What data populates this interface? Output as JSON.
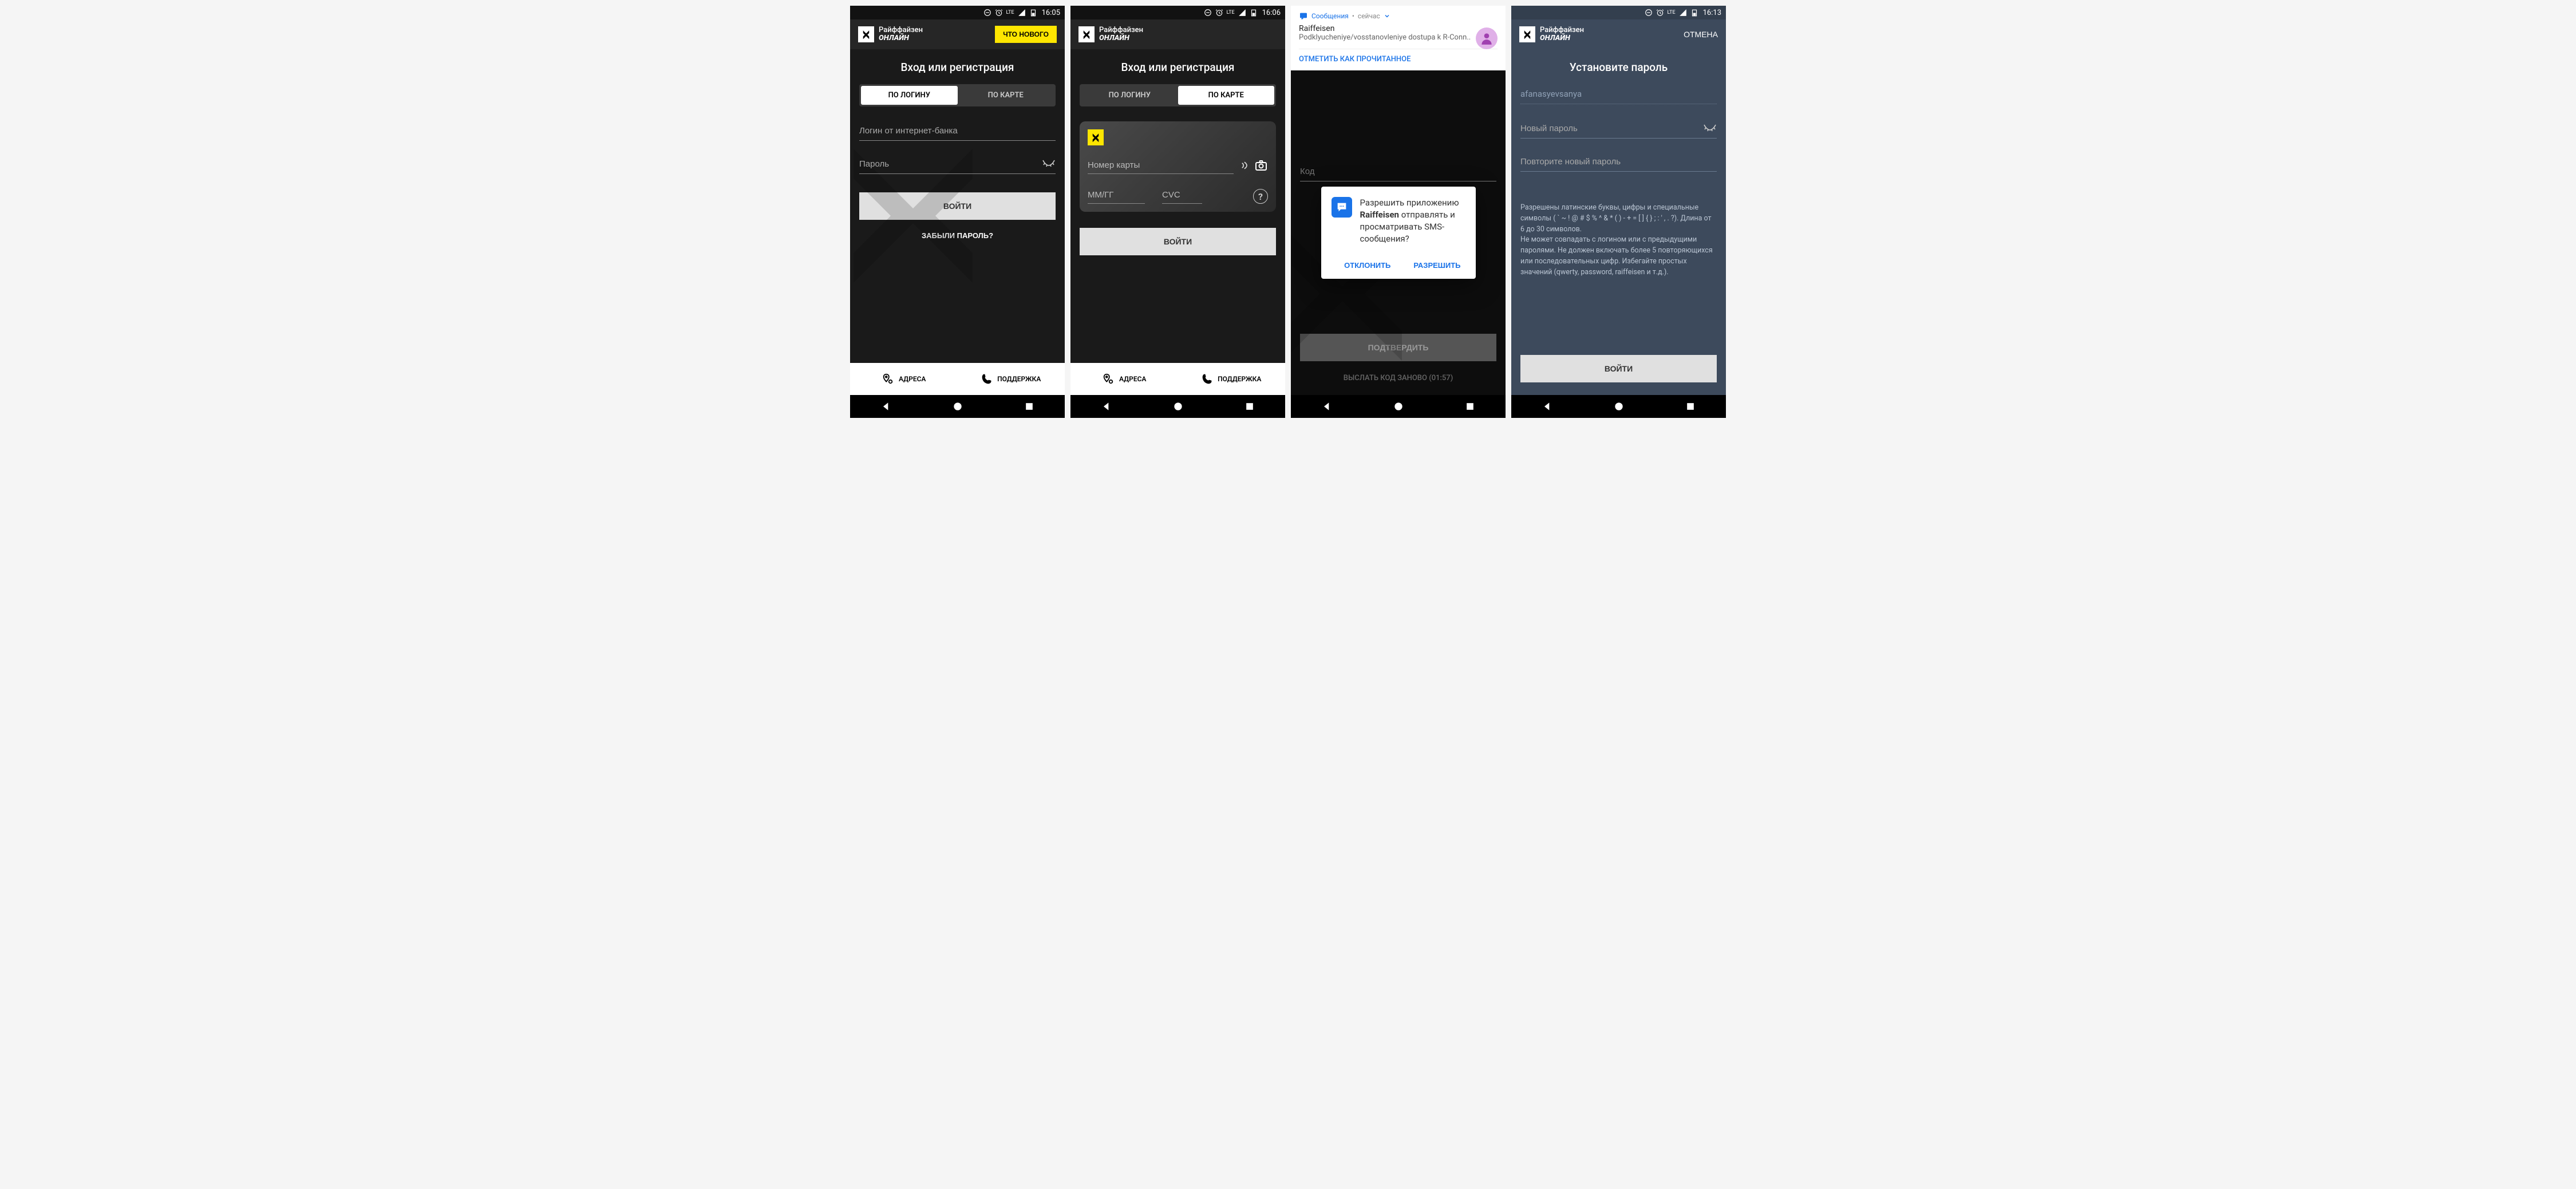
{
  "status": {
    "time1": "16:05",
    "time2": "16:06",
    "time4": "16:13",
    "net": "LTE"
  },
  "brand": {
    "line1": "Райффайзен",
    "line2": "ОНЛАЙН"
  },
  "screen1": {
    "whatsNew": "ЧТО НОВОГО",
    "title": "Вход или регистрация",
    "tabLogin": "ПО ЛОГИНУ",
    "tabCard": "ПО КАРТЕ",
    "loginPlaceholder": "Логин от интернет-банка",
    "passwordPlaceholder": "Пароль",
    "loginBtn": "ВОЙТИ",
    "forgot": "ЗАБЫЛИ ПАРОЛЬ?",
    "addresses": "АДРЕСА",
    "support": "ПОДДЕРЖКА"
  },
  "screen2": {
    "title": "Вход или регистрация",
    "tabLogin": "ПО ЛОГИНУ",
    "tabCard": "ПО КАРТЕ",
    "cardNumberPlaceholder": "Номер карты",
    "expPlaceholder": "ММ/ГГ",
    "cvcPlaceholder": "CVC",
    "loginBtn": "ВОЙТИ",
    "addresses": "АДРЕСА",
    "support": "ПОДДЕРЖКА"
  },
  "screen3": {
    "notifApp": "Сообщения",
    "notifWhen": "сейчас",
    "notifTitle": "Raiffeisen",
    "notifBody": "Podklyucheniye/vosstanovleniye dostupa k R-Conn..",
    "notifMark": "ОТМЕТИТЬ КАК ПРОЧИТАННОЕ",
    "codePlaceholder": "Код",
    "dialogLine1": "Разрешить приложению",
    "dialogAppName": "Raiffeisen",
    "dialogLine2": "отправлять и просматривать SMS-сообщения?",
    "deny": "ОТКЛОНИТЬ",
    "allow": "РАЗРЕШИТЬ",
    "confirm": "ПОДТВЕРДИТЬ",
    "resend": "ВЫСЛАТЬ КОД ЗАНОВО (01:57)"
  },
  "screen4": {
    "cancel": "ОТМЕНА",
    "title": "Установите пароль",
    "username": "afanasyevsanya",
    "newPwPlaceholder": "Новый пароль",
    "repeatPwPlaceholder": "Повторите новый пароль",
    "hint1": "Разрешены латинские буквы, цифры и специальные символы ( ` ~ ! @ # $ % ^ & * ( ) - + = [ ] { } ; : ' , . ?). Длина от 6 до 30 символов.",
    "hint2": "Не может совпадать с логином или с предыдущими паролями. Не должен включать более 5 повторяющихся или последовательных цифр. Избегайте простых значений (qwerty, password, raiffeisen и т.д.).",
    "loginBtn": "ВОЙТИ"
  }
}
